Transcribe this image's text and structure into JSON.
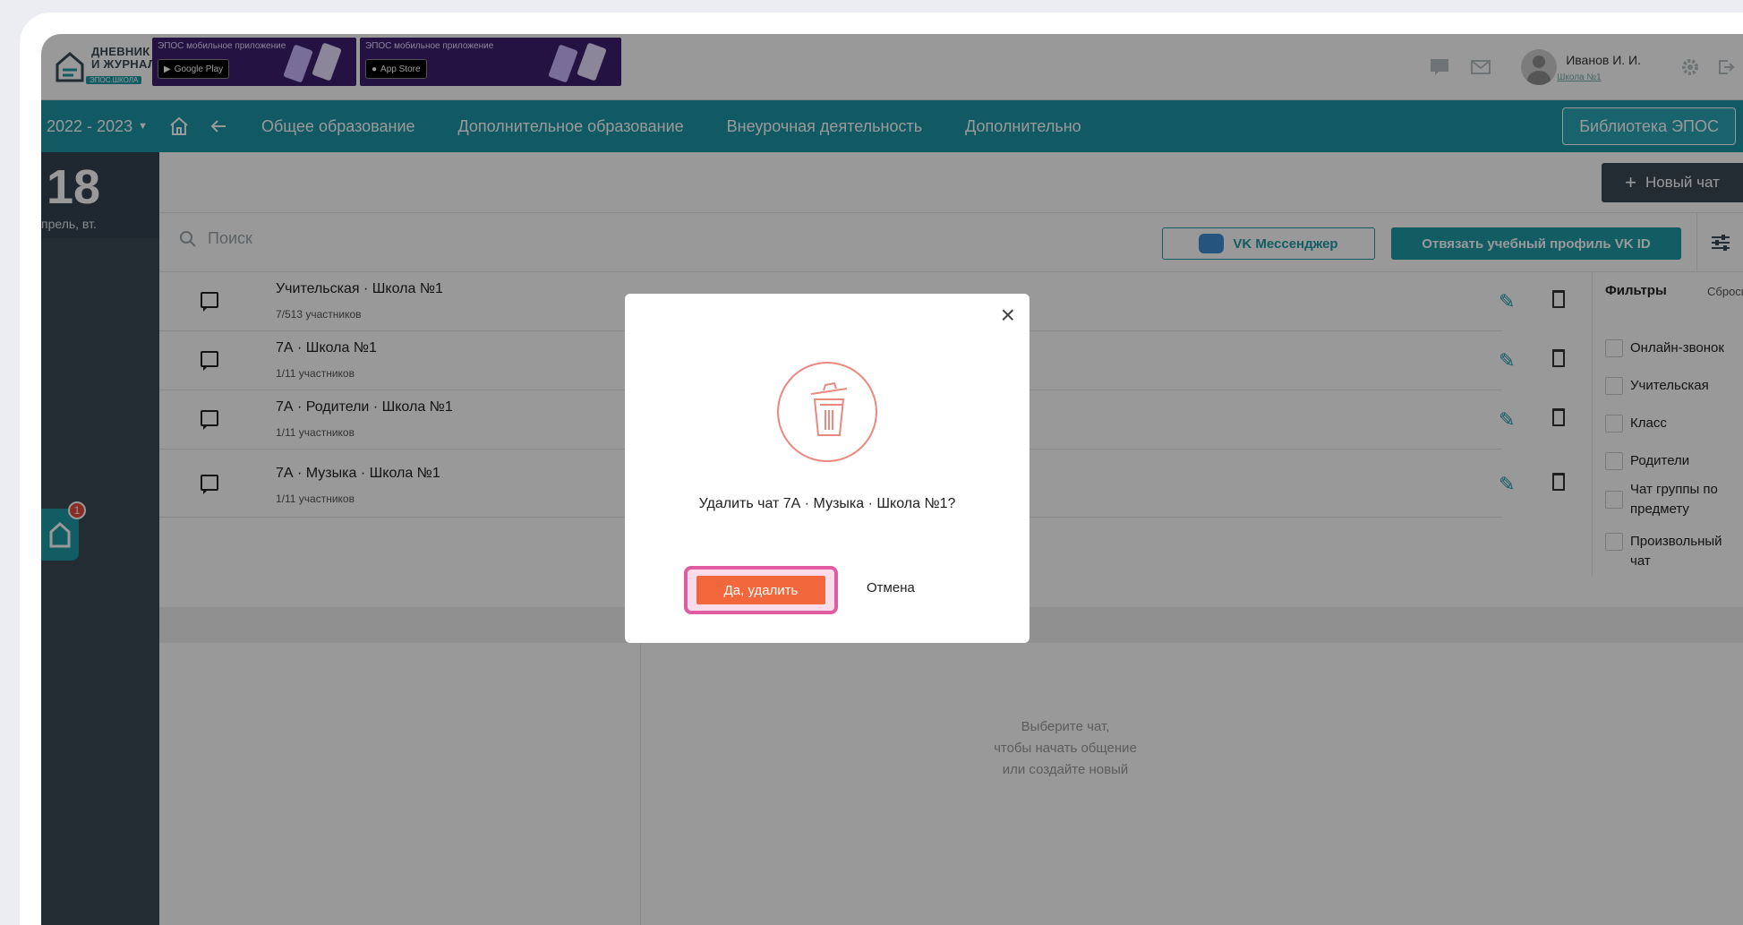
{
  "header": {
    "logo_line1": "ДНЕВНИК",
    "logo_line2": "И ЖУРНАЛ",
    "logo_sub": "ЭПОС.ШКОЛА",
    "banners": [
      {
        "title": "ЭПОС мобильное приложение",
        "store": "Google Play"
      },
      {
        "title": "ЭПОС мобильное приложение",
        "store": "App Store"
      }
    ],
    "user_name": "Иванов И. И.",
    "user_school": "Школа №1"
  },
  "nav": {
    "year": "2022 - 2023",
    "items": [
      "Общее образование",
      "Дополнительное образование",
      "Внеурочная деятельность",
      "Дополнительно"
    ],
    "library_button": "Библиотека ЭПОС"
  },
  "date": {
    "day": "18",
    "sub": "прель, вт."
  },
  "fab_badge": "1",
  "toolbar": {
    "new_chat": "Новый чат",
    "search_placeholder": "Поиск",
    "vk_messenger": "VK Мессенджер",
    "unlink_profile": "Отвязать учебный профиль VK ID"
  },
  "chats": [
    {
      "title": "Учительская · Школа №1",
      "count": "7/513 участников"
    },
    {
      "title": "7А · Школа №1",
      "count": "1/11 участников"
    },
    {
      "title": "7А · Родители · Школа №1",
      "count": "1/11 участников"
    },
    {
      "title": "7А · Музыка · Школа №1",
      "count": "1/11 участников"
    }
  ],
  "filters": {
    "title": "Фильтры",
    "reset": "Сбросит",
    "items": [
      "Онлайн-звонок",
      "Учительская",
      "Класс",
      "Родители",
      "Чат группы по предмету",
      "Произвольный чат"
    ]
  },
  "empty_hint": [
    "Выберите чат,",
    "чтобы начать общение",
    "или создайте новый"
  ],
  "dialog": {
    "close": "×",
    "question": "Удалить чат 7А · Музыка · Школа №1?",
    "confirm": "Да, удалить",
    "cancel": "Отмена"
  },
  "colors": {
    "teal": "#1d97a6",
    "dark": "#3b4a54",
    "accent": "#f2683c",
    "highlight": "#e15ba0"
  }
}
